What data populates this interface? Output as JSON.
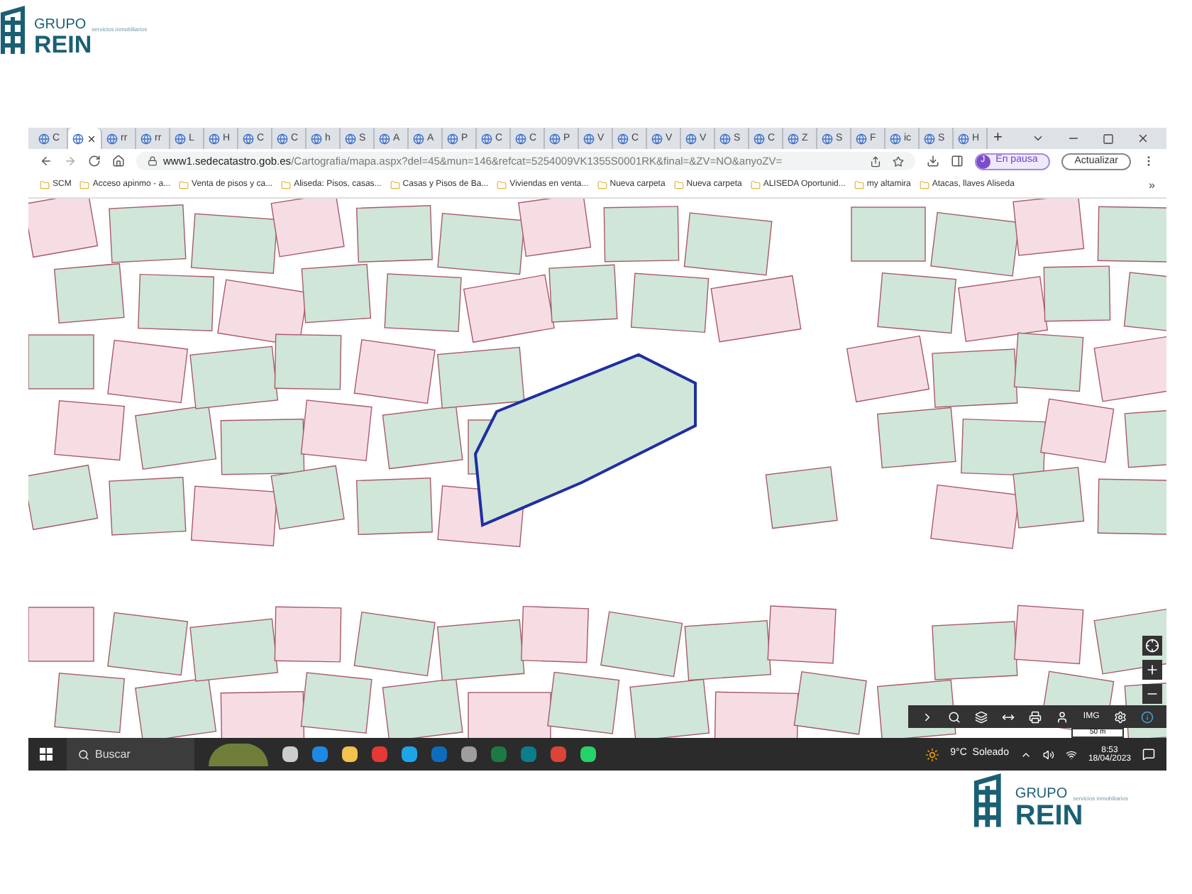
{
  "logo_top": {
    "word1": "GRUPO",
    "word2": "REIN",
    "tagline": "servicios inmobiliarios"
  },
  "browser": {
    "tabs": [
      {
        "label": "C",
        "selected": false
      },
      {
        "selected": true
      },
      {
        "label": "rr",
        "selected": false
      },
      {
        "label": "rr",
        "selected": false
      },
      {
        "label": "L",
        "selected": false
      },
      {
        "label": "H",
        "selected": false
      },
      {
        "label": "C",
        "selected": false
      },
      {
        "label": "C",
        "selected": false
      },
      {
        "label": "h",
        "selected": false
      },
      {
        "label": "S",
        "selected": false
      },
      {
        "label": "A",
        "selected": false
      },
      {
        "label": "A",
        "selected": false
      },
      {
        "label": "P",
        "selected": false
      },
      {
        "label": "C",
        "selected": false
      },
      {
        "label": "C",
        "selected": false
      },
      {
        "label": "P",
        "selected": false
      },
      {
        "label": "V",
        "selected": false
      },
      {
        "label": "C",
        "selected": false
      },
      {
        "label": "V",
        "selected": false
      },
      {
        "label": "V",
        "selected": false
      },
      {
        "label": "S",
        "selected": false
      },
      {
        "label": "C",
        "selected": false
      },
      {
        "label": "Z",
        "selected": false
      },
      {
        "label": "S",
        "selected": false
      },
      {
        "label": "F",
        "selected": false
      },
      {
        "label": "ic",
        "selected": false
      },
      {
        "label": "S",
        "selected": false
      },
      {
        "label": "H",
        "selected": false
      }
    ],
    "new_tab": "+",
    "url_host": "www1.sedecatastro.gob.es",
    "url_path": "/Cartografia/mapa.aspx?del=45&mun=146&refcat=5254009VK1355S0001RK&final=&ZV=NO&anyoZV=",
    "profile": {
      "initial": "J",
      "label": "En pausa"
    },
    "update_button": "Actualizar",
    "bookmarks": [
      "SCM",
      "Acceso apinmo - a...",
      "Venta de pisos y ca...",
      "Aliseda: Pisos, casas...",
      "Casas y Pisos de Ba...",
      "Viviendas en venta...",
      "Nueva carpeta",
      "Nueva carpeta",
      "ALISEDA Oportunid...",
      "my altamira",
      "Atacas, llaves Aliseda"
    ],
    "bookmarks_more": "»"
  },
  "map": {
    "toolbar_text": "IMG",
    "scale": "50 m"
  },
  "taskbar": {
    "search": "Buscar",
    "weather": "9°C  Soleado",
    "time": "8:53",
    "date": "18/04/2023"
  },
  "logo_bottom": {
    "word1": "GRUPO",
    "word2": "REIN",
    "tagline": "servicios inmobiliarios"
  }
}
